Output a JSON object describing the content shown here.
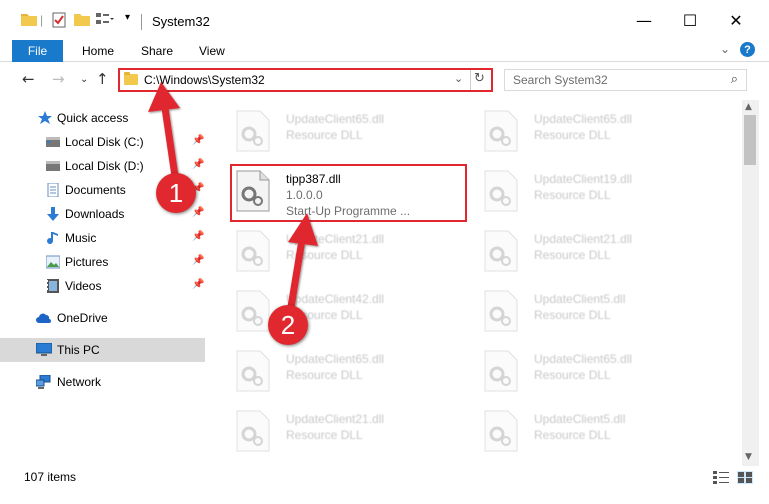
{
  "window": {
    "title": "System32",
    "minimize": "—",
    "maximize": "☐",
    "close": "✕"
  },
  "ribbon": {
    "file": "File",
    "home": "Home",
    "share": "Share",
    "view": "View"
  },
  "address": {
    "path": "C:\\Windows\\System32",
    "search_placeholder": "Search System32"
  },
  "sidebar": {
    "items": [
      {
        "label": "Quick access",
        "icon": "star-icon",
        "pinned": false
      },
      {
        "label": "Local Disk (C:)",
        "icon": "drive-icon",
        "pinned": true
      },
      {
        "label": "Local Disk (D:)",
        "icon": "drive-icon",
        "pinned": true
      },
      {
        "label": "Documents",
        "icon": "documents-icon",
        "pinned": true
      },
      {
        "label": "Downloads",
        "icon": "download-icon",
        "pinned": true
      },
      {
        "label": "Music",
        "icon": "music-icon",
        "pinned": true
      },
      {
        "label": "Pictures",
        "icon": "pictures-icon",
        "pinned": true
      },
      {
        "label": "Videos",
        "icon": "videos-icon",
        "pinned": true
      },
      {
        "label": "OneDrive",
        "icon": "cloud-icon",
        "pinned": false
      },
      {
        "label": "This PC",
        "icon": "computer-icon",
        "pinned": false
      },
      {
        "label": "Network",
        "icon": "network-icon",
        "pinned": false
      }
    ]
  },
  "files": {
    "left": [
      {
        "name": "UpdateClient65.dll",
        "type": "Resource DLL"
      },
      {
        "name": "tipp387.dll",
        "type": "1.0.0.0",
        "extra": "Start-Up Programme ..."
      },
      {
        "name": "UpdateClient21.dll",
        "type": "Resource DLL"
      },
      {
        "name": "UpdateClient42.dll",
        "type": "Resource DLL"
      },
      {
        "name": "UpdateClient65.dll",
        "type": "Resource DLL"
      },
      {
        "name": "UpdateClient21.dll",
        "type": "Resource DLL"
      }
    ],
    "right": [
      {
        "name": "UpdateClient65.dll",
        "type": "Resource DLL"
      },
      {
        "name": "UpdateClient19.dll",
        "type": "Resource DLL"
      },
      {
        "name": "UpdateClient21.dll",
        "type": "Resource DLL"
      },
      {
        "name": "UpdateClient5.dll",
        "type": "Resource DLL"
      },
      {
        "name": "UpdateClient65.dll",
        "type": "Resource DLL"
      },
      {
        "name": "UpdateClient5.dll",
        "type": "Resource DLL"
      }
    ]
  },
  "status": {
    "item_count": "107 items"
  },
  "annotations": {
    "step1": "1",
    "step2": "2",
    "color": "#e0282e"
  }
}
